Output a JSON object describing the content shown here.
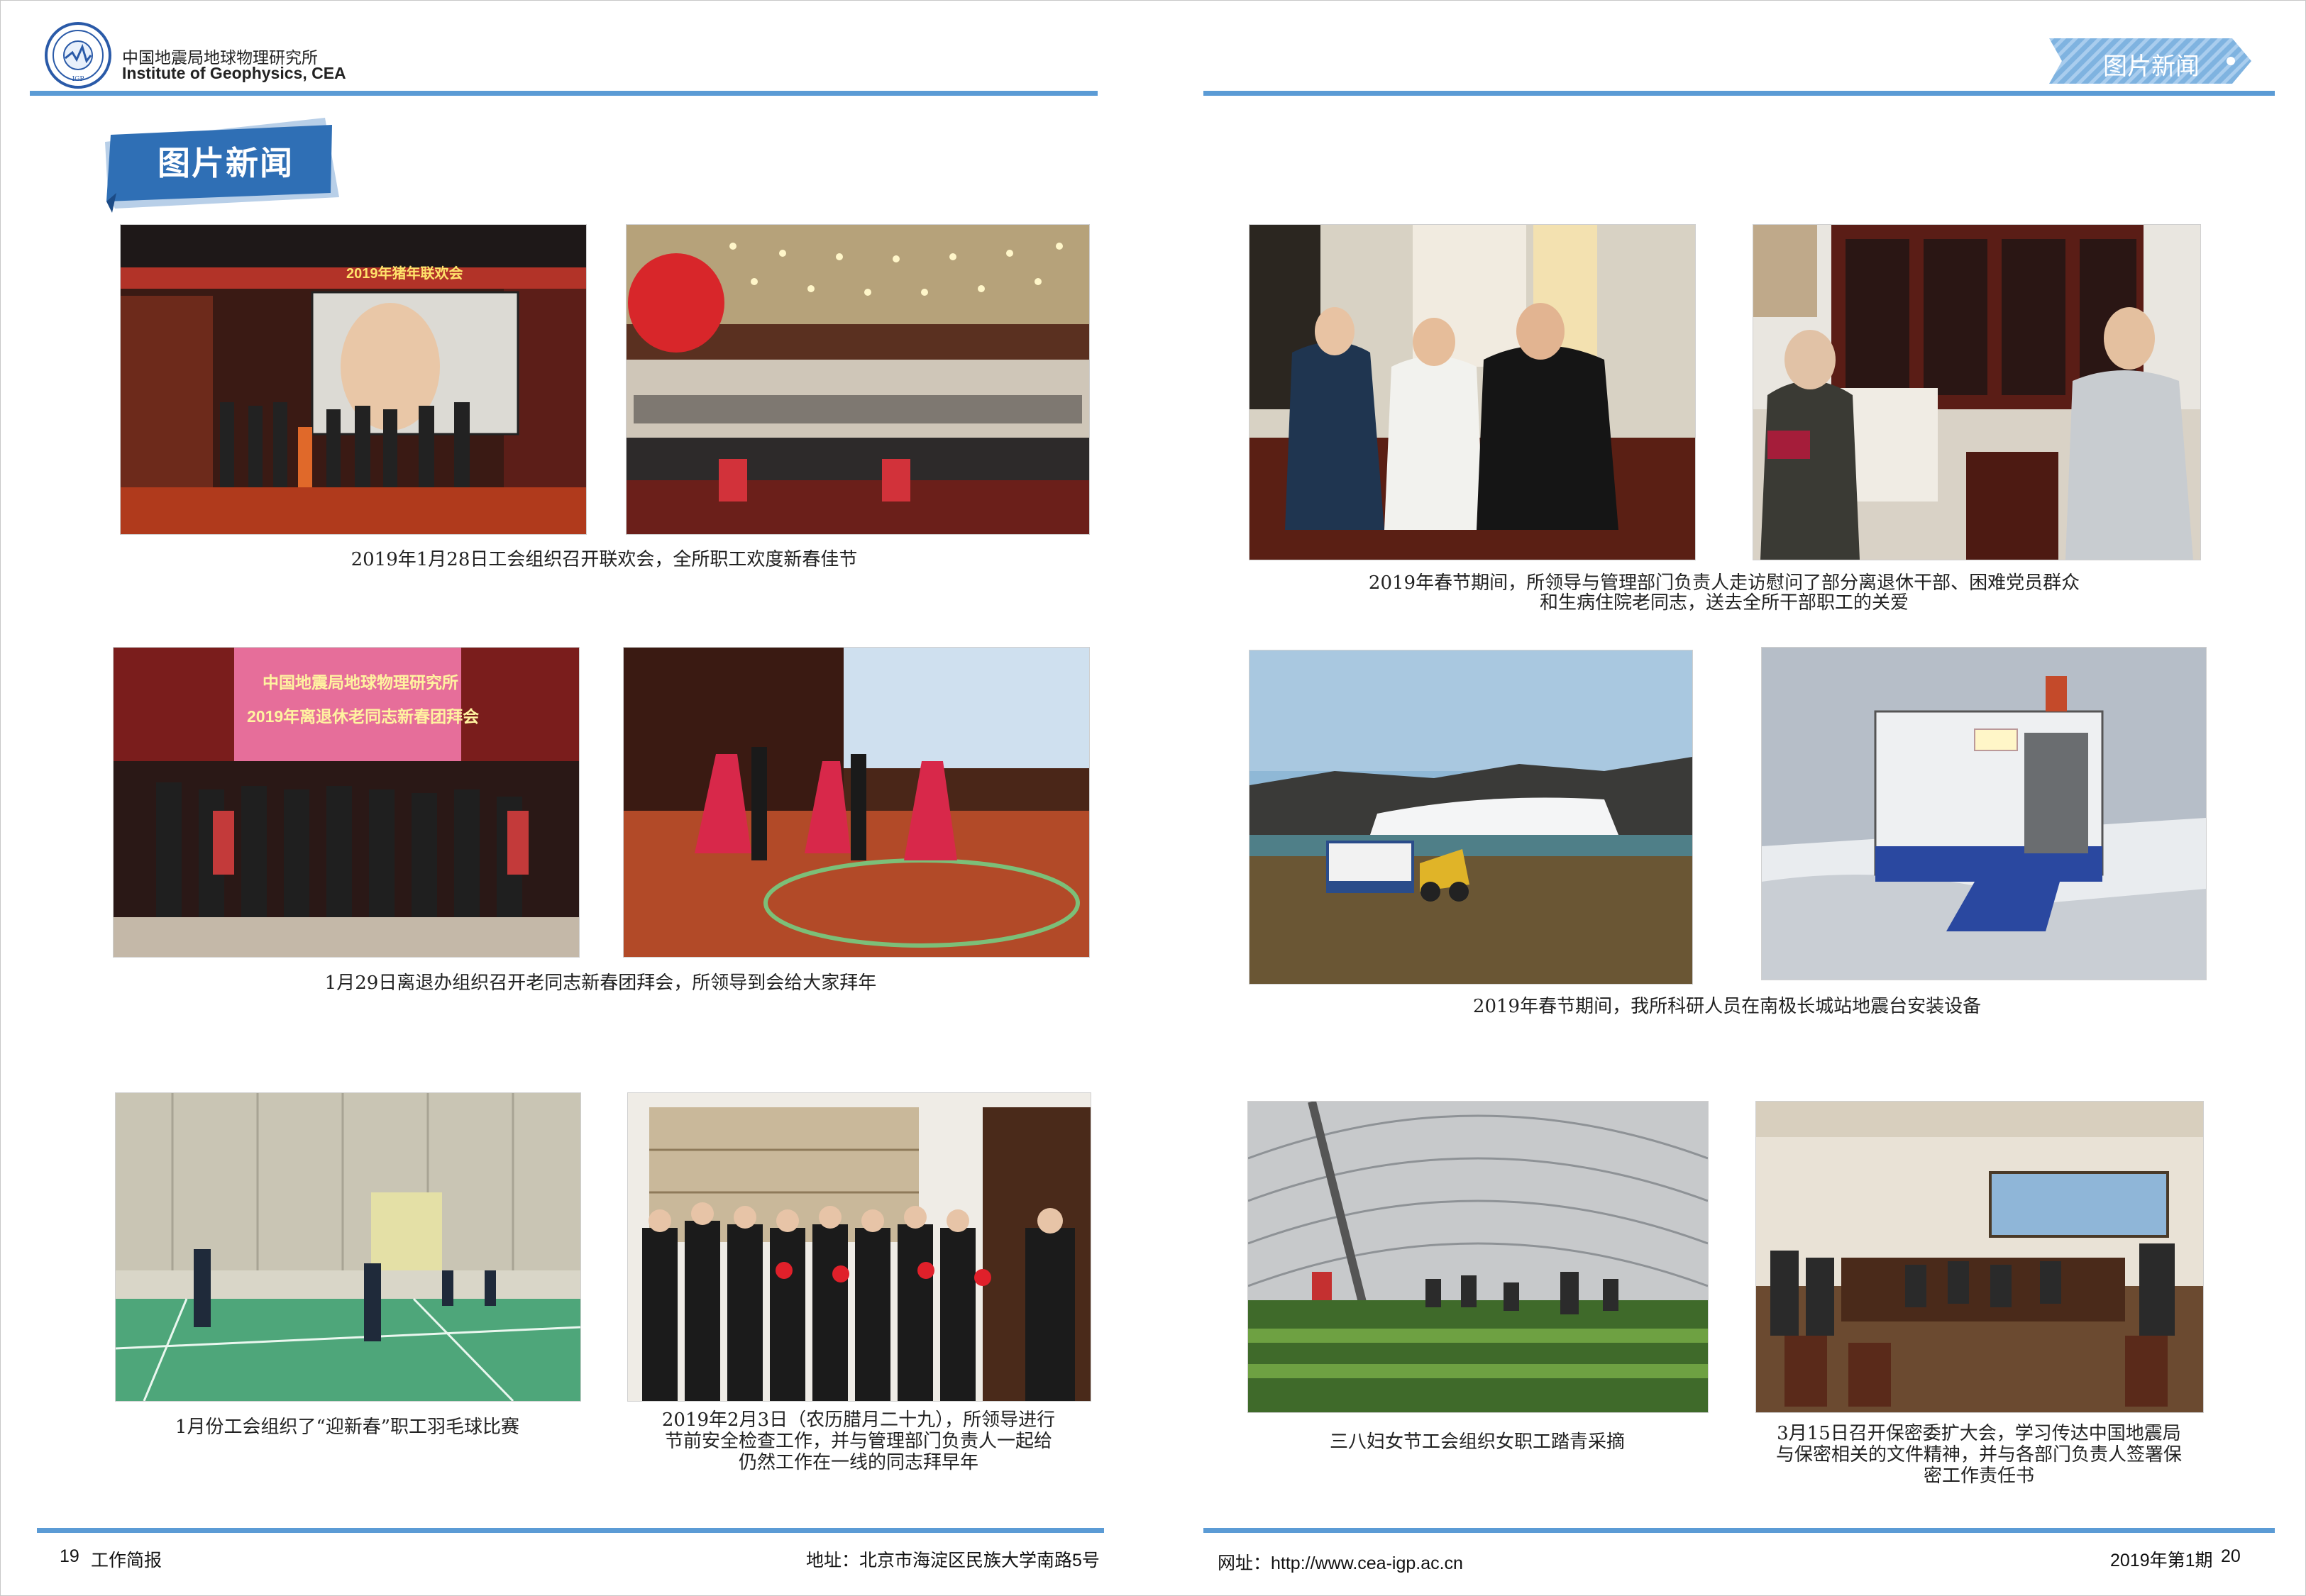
{
  "header": {
    "org_cn": "中国地震局地球物理研究所",
    "org_en": "Institute of Geophysics, CEA",
    "section_tab": "图片新闻"
  },
  "banner": {
    "title": "图片新闻"
  },
  "captions": {
    "l1": "2019年1月28日工会组织召开联欢会，全所职工欢度新春佳节",
    "l2": "1月29日离退办组织召开老同志新春团拜会，所领导到会给大家拜年",
    "l3a": "1月份工会组织了“迎新春”职工羽毛球比赛",
    "l3b_1": "2019年2月3日（农历腊月二十九），所领导进行",
    "l3b_2": "节前安全检查工作，并与管理部门负责人一起给",
    "l3b_3": "仍然工作在一线的同志拜早年",
    "r1_1": "2019年春节期间，所领导与管理部门负责人走访慰问了部分离退休干部、困难党员群众",
    "r1_2": "和生病住院老同志，送去全所干部职工的关爱",
    "r2": "2019年春节期间，我所科研人员在南极长城站地震台安装设备",
    "r3a": "三八妇女节工会组织女职工踏青采摘",
    "r3b_1": "3月15日召开保密委扩大会，学习传达中国地震局",
    "r3b_2": "与保密相关的文件精神，并与各部门负责人签署保",
    "r3b_3": "密工作责任书"
  },
  "photo_text": {
    "gala_banner": "2019年猪年联欢会",
    "reunion_line1": "中国地震局地球物理研究所",
    "reunion_line2": "2019年离退休老同志新春团拜会"
  },
  "footer": {
    "left_page": "19",
    "left_title": "工作简报",
    "address": "地址：北京市海淀区民族大学南路5号",
    "website": "网址：http://www.cea-igp.ac.cn",
    "issue": "2019年第1期",
    "right_page": "20"
  }
}
